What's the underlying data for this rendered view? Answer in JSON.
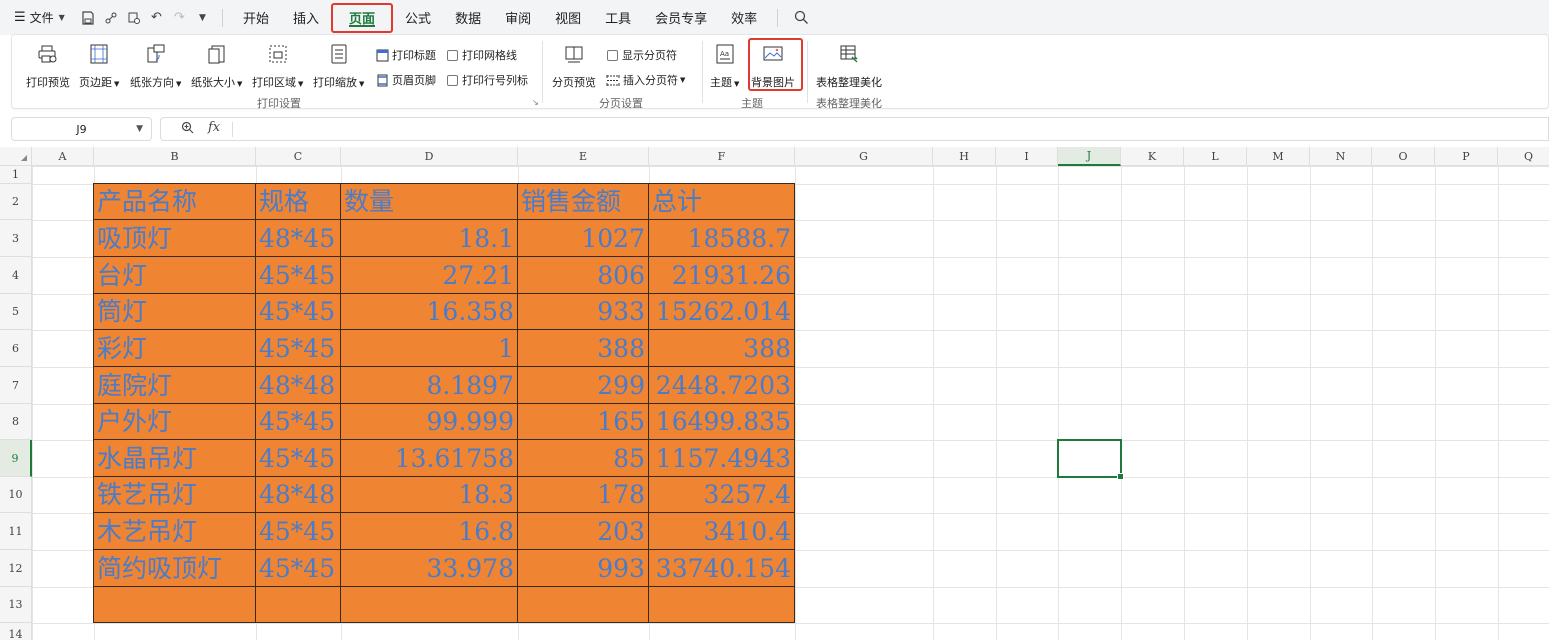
{
  "menubar": {
    "file_label": "文件",
    "tabs": [
      "开始",
      "插入",
      "页面",
      "公式",
      "数据",
      "审阅",
      "视图",
      "工具",
      "会员专享",
      "效率"
    ],
    "active_tab": "页面"
  },
  "ribbon": {
    "print_group": {
      "label": "打印设置",
      "print_preview": "打印预览",
      "margins": "页边距",
      "orientation": "纸张方向",
      "paper_size": "纸张大小",
      "print_area": "打印区域",
      "print_scale": "打印缩放",
      "print_titles": "打印标题",
      "header_footer": "页眉页脚",
      "print_gridlines": "打印网格线",
      "print_row_col_headers": "打印行号列标"
    },
    "pagebreak_group": {
      "label": "分页设置",
      "pagebreak_preview": "分页预览",
      "show_pagebreaks": "显示分页符",
      "insert_pagebreak": "插入分页符"
    },
    "theme_group": {
      "label": "主题",
      "theme": "主题",
      "background_image": "背景图片"
    },
    "beautify_group": {
      "label": "表格整理美化",
      "beautify": "表格整理美化"
    }
  },
  "formula_bar": {
    "name_box": "J9",
    "fx_label": "fx",
    "formula": ""
  },
  "grid": {
    "columns": [
      "A",
      "B",
      "C",
      "D",
      "E",
      "F",
      "G",
      "H",
      "I",
      "J",
      "K",
      "L",
      "M",
      "N",
      "O",
      "P",
      "Q"
    ],
    "rows": [
      "1",
      "2",
      "3",
      "4",
      "5",
      "6",
      "7",
      "8",
      "9",
      "10",
      "11",
      "12",
      "13",
      "14"
    ],
    "selected_column": "J",
    "selected_row": "9",
    "fill_color": "#ef8432",
    "text_color": "#4a7cc9",
    "accent_green": "#1e7a3b",
    "highlight_red": "#e03a30"
  },
  "table": {
    "headers": [
      "产品名称",
      "规格",
      "数量",
      "销售金额",
      "总计"
    ],
    "rows": [
      [
        "吸顶灯",
        "48*45",
        "18.1",
        "1027",
        "18588.7"
      ],
      [
        "台灯",
        "45*45",
        "27.21",
        "806",
        "21931.26"
      ],
      [
        "筒灯",
        "45*45",
        "16.358",
        "933",
        "15262.014"
      ],
      [
        "彩灯",
        "45*45",
        "1",
        "388",
        "388"
      ],
      [
        "庭院灯",
        "48*48",
        "8.1897",
        "299",
        "2448.7203"
      ],
      [
        "户外灯",
        "45*45",
        "99.999",
        "165",
        "16499.835"
      ],
      [
        "水晶吊灯",
        "45*45",
        "13.61758",
        "85",
        "1157.4943"
      ],
      [
        "铁艺吊灯",
        "48*48",
        "18.3",
        "178",
        "3257.4"
      ],
      [
        "木艺吊灯",
        "45*45",
        "16.8",
        "203",
        "3410.4"
      ],
      [
        "简约吸顶灯",
        "45*45",
        "33.978",
        "993",
        "33740.154"
      ],
      [
        "",
        "",
        "",
        "",
        ""
      ]
    ]
  }
}
